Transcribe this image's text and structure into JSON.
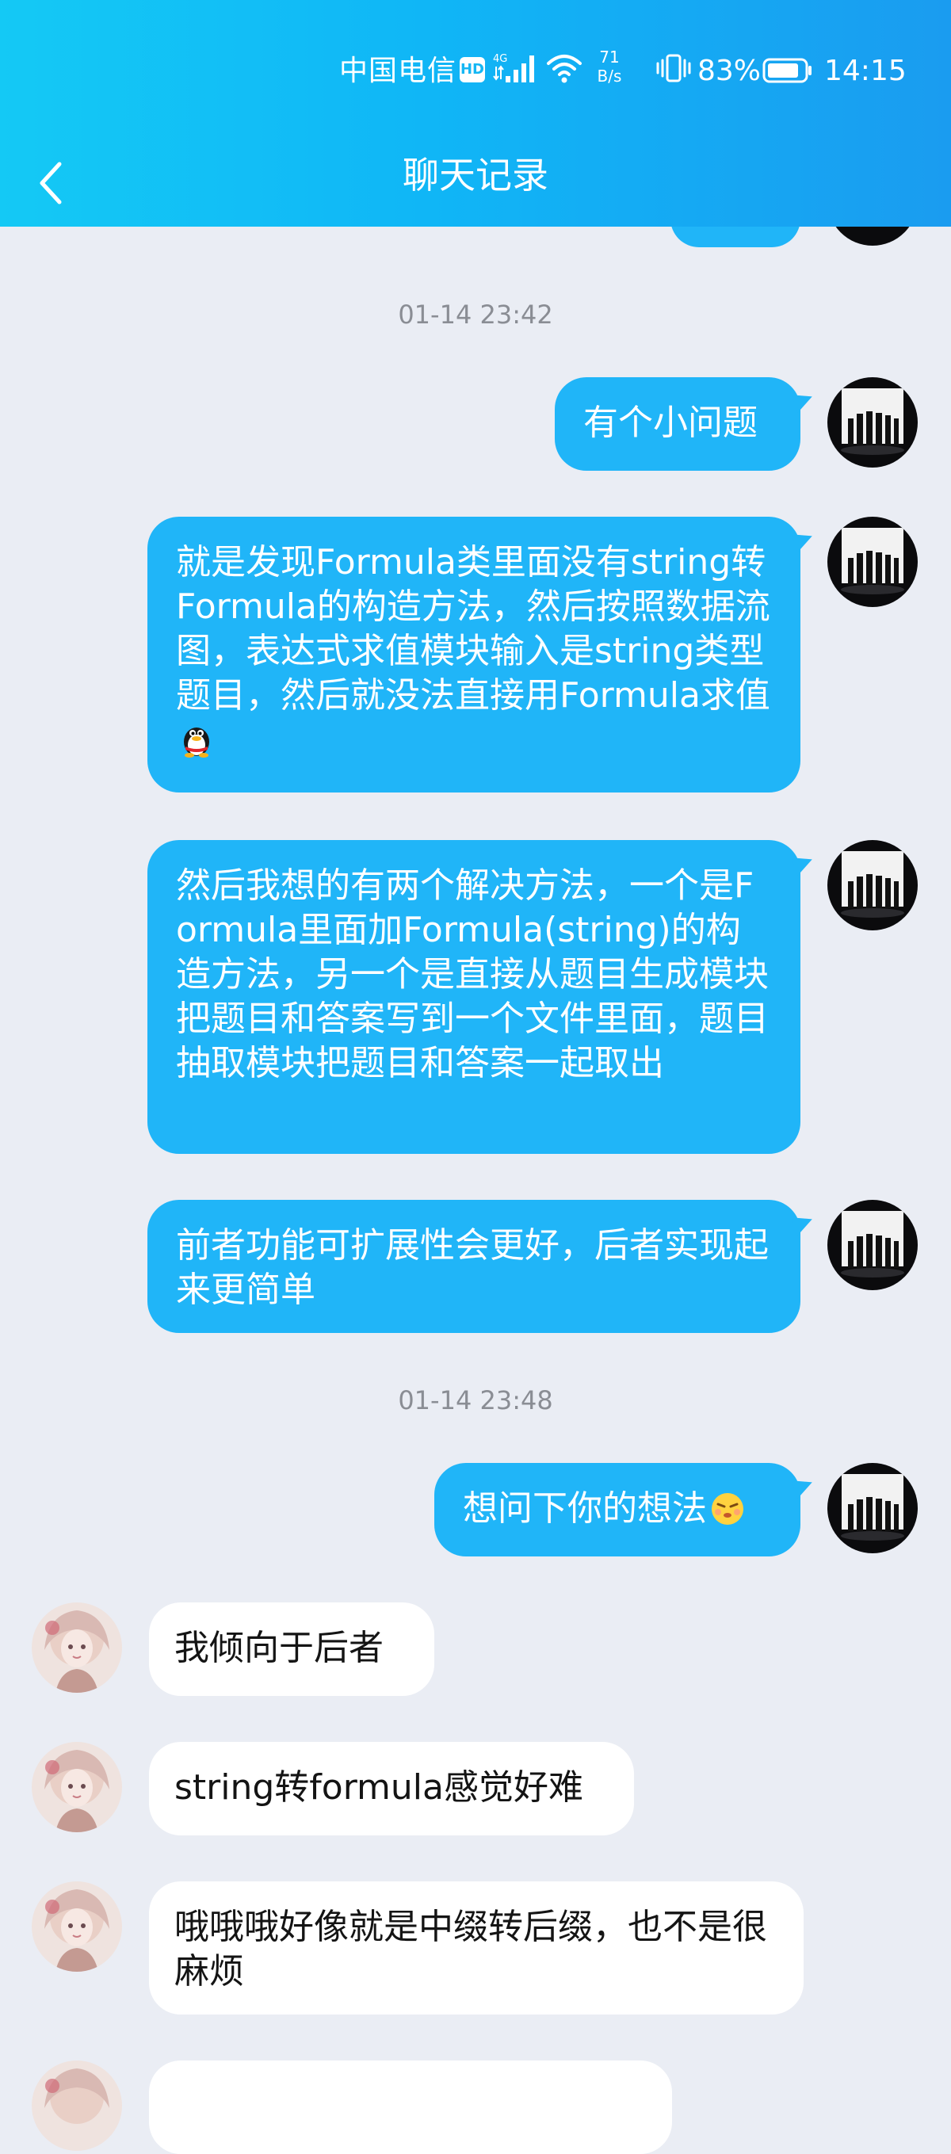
{
  "status_bar": {
    "carrier": "中国电信",
    "hd_badge": "HD",
    "network_type": "4G",
    "net_speed_value": "71",
    "net_speed_unit": "B/s",
    "battery_percent": "83%",
    "time": "14:15"
  },
  "nav": {
    "title": "聊天记录",
    "back_icon": "chevron-left-icon"
  },
  "messages": {
    "ts1": "01-14 23:42",
    "ts2": "01-14 23:48",
    "m1": "有个小问题",
    "m2": "就是发现Formula类里面没有string转Formula的构造方法，然后按照数据流图，表达式求值模块输入是string类型题目，然后就没法直接用Formula求值",
    "m3": "然后我想的有两个解决方法，一个是Formula里面加Formula(string)的构造方法，另一个是直接从题目生成模块把题目和答案写到一个文件里面，题目抽取模块把题目和答案一起取出",
    "m4": "前者功能可扩展性会更好，后者实现起来更简单",
    "m5": "想问下你的想法",
    "r1": "我倾向于后者",
    "r2": "string转formula感觉好难",
    "r3": "哦哦哦好像就是中缀转后缀，也不是很麻烦"
  },
  "icons": {
    "m2_emoji": "qq-penguin-emoji",
    "m5_emoji": "pouting-face-emoji"
  },
  "colors": {
    "header_start": "#14c9f5",
    "header_end": "#1a9cf0",
    "my_bubble": "#20b5f8",
    "their_bubble": "#ffffff",
    "background": "#eaedf4",
    "timestamp_text": "#8a8d94"
  }
}
